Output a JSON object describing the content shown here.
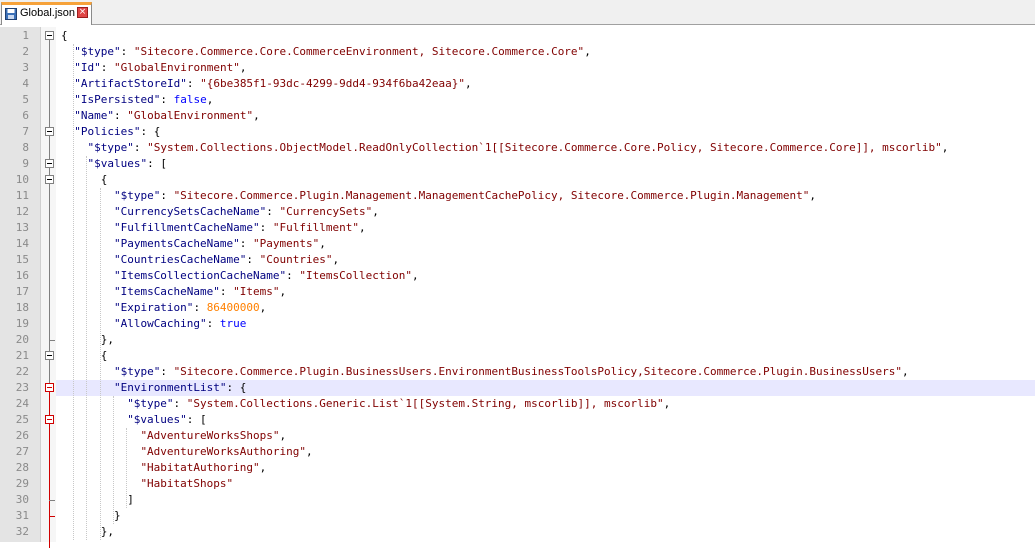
{
  "tab": {
    "title": "Global.json",
    "save_icon": "save-icon",
    "close_icon": "close-icon"
  },
  "editor": {
    "highlighted_line": 23,
    "lines": [
      {
        "n": "1",
        "ind": 0,
        "parts": [
          [
            "p",
            "{"
          ]
        ]
      },
      {
        "n": "2",
        "ind": 2,
        "parts": [
          [
            "k",
            "\"$type\""
          ],
          [
            "p",
            ": "
          ],
          [
            "s",
            "\"Sitecore.Commerce.Core.CommerceEnvironment, Sitecore.Commerce.Core\""
          ],
          [
            "p",
            ","
          ]
        ]
      },
      {
        "n": "3",
        "ind": 2,
        "parts": [
          [
            "k",
            "\"Id\""
          ],
          [
            "p",
            ": "
          ],
          [
            "s",
            "\"GlobalEnvironment\""
          ],
          [
            "p",
            ","
          ]
        ]
      },
      {
        "n": "4",
        "ind": 2,
        "parts": [
          [
            "k",
            "\"ArtifactStoreId\""
          ],
          [
            "p",
            ": "
          ],
          [
            "s",
            "\"{6be385f1-93dc-4299-9dd4-934f6ba42eaa}\""
          ],
          [
            "p",
            ","
          ]
        ]
      },
      {
        "n": "5",
        "ind": 2,
        "parts": [
          [
            "k",
            "\"IsPersisted\""
          ],
          [
            "p",
            ": "
          ],
          [
            "b",
            "false"
          ],
          [
            "p",
            ","
          ]
        ]
      },
      {
        "n": "6",
        "ind": 2,
        "parts": [
          [
            "k",
            "\"Name\""
          ],
          [
            "p",
            ": "
          ],
          [
            "s",
            "\"GlobalEnvironment\""
          ],
          [
            "p",
            ","
          ]
        ]
      },
      {
        "n": "7",
        "ind": 2,
        "parts": [
          [
            "k",
            "\"Policies\""
          ],
          [
            "p",
            ": {"
          ]
        ]
      },
      {
        "n": "8",
        "ind": 4,
        "parts": [
          [
            "k",
            "\"$type\""
          ],
          [
            "p",
            ": "
          ],
          [
            "s",
            "\"System.Collections.ObjectModel.ReadOnlyCollection`1[[Sitecore.Commerce.Core.Policy, Sitecore.Commerce.Core]], mscorlib\""
          ],
          [
            "p",
            ","
          ]
        ]
      },
      {
        "n": "9",
        "ind": 4,
        "parts": [
          [
            "k",
            "\"$values\""
          ],
          [
            "p",
            ": ["
          ]
        ]
      },
      {
        "n": "10",
        "ind": 6,
        "parts": [
          [
            "p",
            "{"
          ]
        ]
      },
      {
        "n": "11",
        "ind": 8,
        "parts": [
          [
            "k",
            "\"$type\""
          ],
          [
            "p",
            ": "
          ],
          [
            "s",
            "\"Sitecore.Commerce.Plugin.Management.ManagementCachePolicy, Sitecore.Commerce.Plugin.Management\""
          ],
          [
            "p",
            ","
          ]
        ]
      },
      {
        "n": "12",
        "ind": 8,
        "parts": [
          [
            "k",
            "\"CurrencySetsCacheName\""
          ],
          [
            "p",
            ": "
          ],
          [
            "s",
            "\"CurrencySets\""
          ],
          [
            "p",
            ","
          ]
        ]
      },
      {
        "n": "13",
        "ind": 8,
        "parts": [
          [
            "k",
            "\"FulfillmentCacheName\""
          ],
          [
            "p",
            ": "
          ],
          [
            "s",
            "\"Fulfillment\""
          ],
          [
            "p",
            ","
          ]
        ]
      },
      {
        "n": "14",
        "ind": 8,
        "parts": [
          [
            "k",
            "\"PaymentsCacheName\""
          ],
          [
            "p",
            ": "
          ],
          [
            "s",
            "\"Payments\""
          ],
          [
            "p",
            ","
          ]
        ]
      },
      {
        "n": "15",
        "ind": 8,
        "parts": [
          [
            "k",
            "\"CountriesCacheName\""
          ],
          [
            "p",
            ": "
          ],
          [
            "s",
            "\"Countries\""
          ],
          [
            "p",
            ","
          ]
        ]
      },
      {
        "n": "16",
        "ind": 8,
        "parts": [
          [
            "k",
            "\"ItemsCollectionCacheName\""
          ],
          [
            "p",
            ": "
          ],
          [
            "s",
            "\"ItemsCollection\""
          ],
          [
            "p",
            ","
          ]
        ]
      },
      {
        "n": "17",
        "ind": 8,
        "parts": [
          [
            "k",
            "\"ItemsCacheName\""
          ],
          [
            "p",
            ": "
          ],
          [
            "s",
            "\"Items\""
          ],
          [
            "p",
            ","
          ]
        ]
      },
      {
        "n": "18",
        "ind": 8,
        "parts": [
          [
            "k",
            "\"Expiration\""
          ],
          [
            "p",
            ": "
          ],
          [
            "n",
            "86400000"
          ],
          [
            "p",
            ","
          ]
        ]
      },
      {
        "n": "19",
        "ind": 8,
        "parts": [
          [
            "k",
            "\"AllowCaching\""
          ],
          [
            "p",
            ": "
          ],
          [
            "b",
            "true"
          ]
        ]
      },
      {
        "n": "20",
        "ind": 6,
        "parts": [
          [
            "p",
            "},"
          ]
        ]
      },
      {
        "n": "21",
        "ind": 6,
        "parts": [
          [
            "p",
            "{"
          ]
        ]
      },
      {
        "n": "22",
        "ind": 8,
        "parts": [
          [
            "k",
            "\"$type\""
          ],
          [
            "p",
            ": "
          ],
          [
            "s",
            "\"Sitecore.Commerce.Plugin.BusinessUsers.EnvironmentBusinessToolsPolicy,Sitecore.Commerce.Plugin.BusinessUsers\""
          ],
          [
            "p",
            ","
          ]
        ]
      },
      {
        "n": "23",
        "ind": 8,
        "parts": [
          [
            "k",
            "\"EnvironmentList\""
          ],
          [
            "p",
            ": {"
          ]
        ]
      },
      {
        "n": "24",
        "ind": 10,
        "parts": [
          [
            "k",
            "\"$type\""
          ],
          [
            "p",
            ": "
          ],
          [
            "s",
            "\"System.Collections.Generic.List`1[[System.String, mscorlib]], mscorlib\""
          ],
          [
            "p",
            ","
          ]
        ]
      },
      {
        "n": "25",
        "ind": 10,
        "parts": [
          [
            "k",
            "\"$values\""
          ],
          [
            "p",
            ": ["
          ]
        ]
      },
      {
        "n": "26",
        "ind": 12,
        "parts": [
          [
            "s",
            "\"AdventureWorksShops\""
          ],
          [
            "p",
            ","
          ]
        ]
      },
      {
        "n": "27",
        "ind": 12,
        "parts": [
          [
            "s",
            "\"AdventureWorksAuthoring\""
          ],
          [
            "p",
            ","
          ]
        ]
      },
      {
        "n": "28",
        "ind": 12,
        "parts": [
          [
            "s",
            "\"HabitatAuthoring\""
          ],
          [
            "p",
            ","
          ]
        ]
      },
      {
        "n": "29",
        "ind": 12,
        "parts": [
          [
            "s",
            "\"HabitatShops\""
          ]
        ]
      },
      {
        "n": "30",
        "ind": 10,
        "parts": [
          [
            "p",
            "]"
          ]
        ]
      },
      {
        "n": "31",
        "ind": 8,
        "parts": [
          [
            "p",
            "}"
          ]
        ]
      },
      {
        "n": "32",
        "ind": 6,
        "parts": [
          [
            "p",
            "},"
          ]
        ]
      }
    ]
  },
  "colors": {
    "string": "#800000",
    "key": "#000080",
    "bool": "#0000ff",
    "number": "#ff8000",
    "fold_active": "#d00000"
  }
}
